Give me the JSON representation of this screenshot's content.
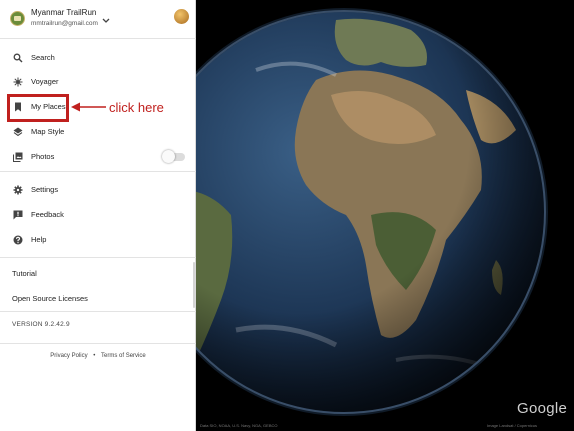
{
  "account": {
    "name": "Myanmar TrailRun",
    "email": "mmtrailrun@gmail.com"
  },
  "menu": {
    "items": [
      {
        "label": "Search",
        "icon": "search-icon"
      },
      {
        "label": "Voyager",
        "icon": "voyager-icon"
      },
      {
        "label": "My Places",
        "icon": "bookmark-icon"
      },
      {
        "label": "Map Style",
        "icon": "layers-icon"
      },
      {
        "label": "Photos",
        "icon": "photos-icon"
      },
      {
        "label": "Settings",
        "icon": "gear-icon"
      },
      {
        "label": "Feedback",
        "icon": "feedback-icon"
      },
      {
        "label": "Help",
        "icon": "help-icon"
      }
    ],
    "photos_toggle_on": false
  },
  "links": {
    "tutorial": "Tutorial",
    "open_source": "Open Source Licenses"
  },
  "version": "VERSION 9.2.42.9",
  "footer": {
    "privacy": "Privacy Policy",
    "separator": "•",
    "terms": "Terms of Service"
  },
  "annotation": {
    "callout": "click here",
    "color": "#c0201e"
  },
  "map": {
    "logo": "Google",
    "attribution_left": "Data SIO, NOAA, U.S. Navy, NGA, GEBCO",
    "attribution_right": "Image Landsat / Copernicus"
  },
  "colors": {
    "sidebar_bg": "#ffffff",
    "space_bg": "#000000"
  }
}
